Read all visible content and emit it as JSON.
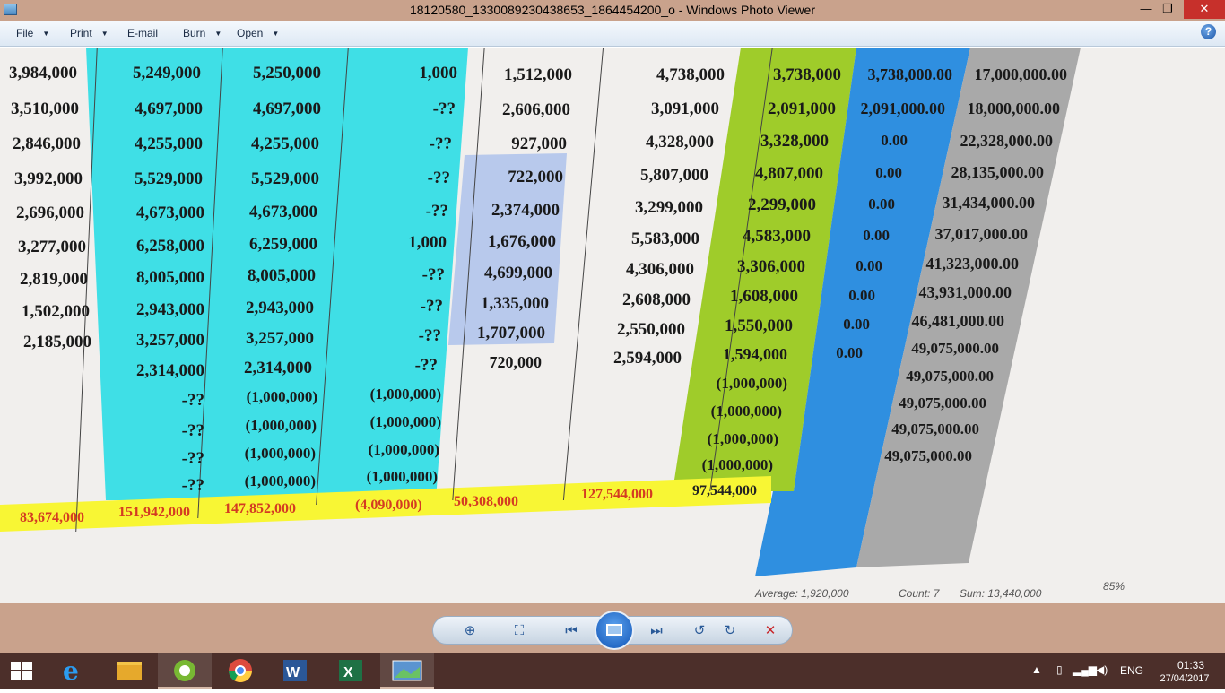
{
  "window": {
    "title": "18120580_1330089230438653_1864454200_o - Windows Photo Viewer",
    "minimize_glyph": "—",
    "maximize_glyph": "❐",
    "close_glyph": "✕"
  },
  "menu": {
    "items": [
      {
        "label": "File",
        "caret": "▼"
      },
      {
        "label": "Print",
        "caret": "▼"
      },
      {
        "label": "E-mail",
        "caret": ""
      },
      {
        "label": "Burn",
        "caret": "▼"
      },
      {
        "label": "Open",
        "caret": "▼"
      }
    ],
    "help_glyph": "?"
  },
  "sheet": {
    "col_a": [
      "3,984,000",
      "3,510,000",
      "2,846,000",
      "3,992,000",
      "2,696,000",
      "3,277,000",
      "2,819,000",
      "1,502,000",
      "2,185,000"
    ],
    "col_b": [
      "5,249,000",
      "4,697,000",
      "4,255,000",
      "5,529,000",
      "4,673,000",
      "6,258,000",
      "8,005,000",
      "2,943,000",
      "3,257,000",
      "2,314,000",
      "-??",
      "-??",
      "-??",
      "-??"
    ],
    "col_c": [
      "5,250,000",
      "4,697,000",
      "4,255,000",
      "5,529,000",
      "4,673,000",
      "6,259,000",
      "8,005,000",
      "2,943,000",
      "3,257,000",
      "2,314,000",
      "(1,000,000)",
      "(1,000,000)",
      "(1,000,000)",
      "(1,000,000)"
    ],
    "col_d": [
      "1,000",
      "-??",
      "-??",
      "-??",
      "-??",
      "1,000",
      "-??",
      "-??",
      "-??",
      "-??",
      "(1,000,000)",
      "(1,000,000)",
      "(1,000,000)",
      "(1,000,000)"
    ],
    "col_e": [
      "1,512,000",
      "2,606,000",
      "927,000",
      "722,000",
      "2,374,000",
      "1,676,000",
      "4,699,000",
      "1,335,000",
      "1,707,000",
      "720,000"
    ],
    "col_f": [
      "4,738,000",
      "3,091,000",
      "4,328,000",
      "5,807,000",
      "3,299,000",
      "5,583,000",
      "4,306,000",
      "2,608,000",
      "2,550,000",
      "2,594,000"
    ],
    "col_g": [
      "3,738,000",
      "2,091,000",
      "3,328,000",
      "4,807,000",
      "2,299,000",
      "4,583,000",
      "3,306,000",
      "1,608,000",
      "1,550,000",
      "1,594,000",
      "(1,000,000)",
      "(1,000,000)",
      "(1,000,000)",
      "(1,000,000)"
    ],
    "col_h": [
      "3,738,000.00",
      "2,091,000.00",
      "0.00",
      "0.00",
      "0.00",
      "0.00",
      "0.00",
      "0.00",
      "0.00",
      "0.00"
    ],
    "col_i": [
      "17,000,000.00",
      "18,000,000.00",
      "22,328,000.00",
      "28,135,000.00",
      "31,434,000.00",
      "37,017,000.00",
      "41,323,000.00",
      "43,931,000.00",
      "46,481,000.00",
      "49,075,000.00",
      "49,075,000.00",
      "49,075,000.00",
      "49,075,000.00",
      "49,075,000.00"
    ],
    "totals": [
      "83,674,000",
      "151,942,000",
      "147,852,000",
      "(4,090,000)",
      "50,308,000",
      "127,544,000",
      "97,544,000"
    ],
    "status": {
      "average": "Average: 1,920,000",
      "count": "Count: 7",
      "sum": "Sum: 13,440,000",
      "zoom": "85%"
    },
    "colors": {
      "cyan": "#3fdfe6",
      "green": "#9fcc2a",
      "blue": "#2f8fe0",
      "gray": "#a9a9a9",
      "yellow": "#f8f634",
      "selected": "#b8c9ec",
      "total_text": "#d43b22"
    }
  },
  "viewer_controls": {
    "zoom_icon": "zoom-icon",
    "zoom_glyph": "⊕",
    "actual_size_glyph": "⛶",
    "prev_glyph": "⏮",
    "next_glyph": "⏭",
    "rotate_ccw_glyph": "↺",
    "rotate_cw_glyph": "↻",
    "delete_glyph": "✕"
  },
  "taskbar": {
    "language": "ENG",
    "time": "01:33",
    "date": "27/04/2017",
    "apps": [
      "internet-explorer",
      "file-explorer",
      "recorder",
      "chrome",
      "word",
      "excel",
      "photo-viewer"
    ]
  }
}
